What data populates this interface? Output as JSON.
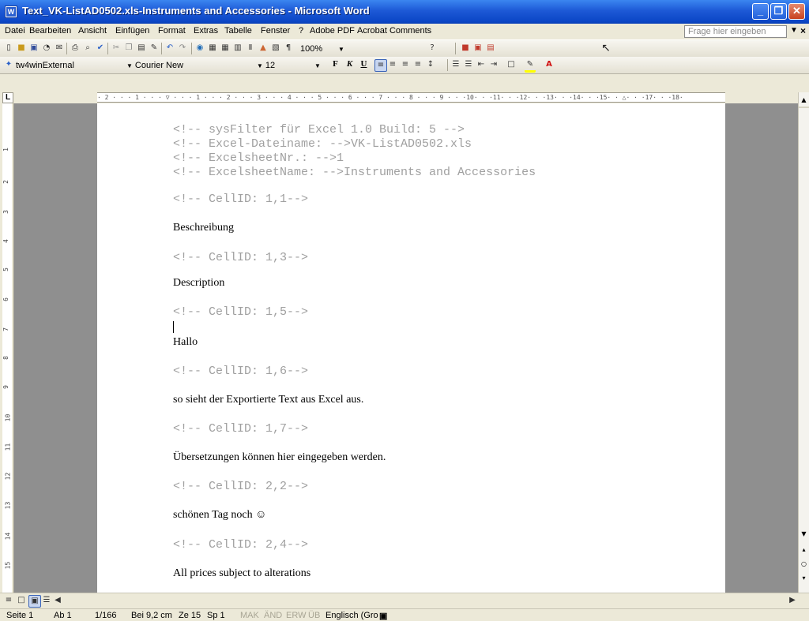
{
  "window": {
    "title": "Text_VK-ListAD0502.xls-Instruments and Accessories - Microsoft Word",
    "app_icon": "W",
    "accent": "#1d59d6",
    "close_color": "#c8421f"
  },
  "menu": {
    "items": [
      "Datei",
      "Bearbeiten",
      "Ansicht",
      "Einfügen",
      "Format",
      "Extras",
      "Tabelle",
      "Fenster",
      "?",
      "Adobe PDF",
      "Acrobat Comments"
    ],
    "help_placeholder": "Frage hier eingeben"
  },
  "toolbar": {
    "zoom": "100%",
    "style": "tw4winExternal",
    "font": "Courier New",
    "size": "12",
    "bold": "F",
    "italic": "K",
    "underline": "U"
  },
  "ruler": {
    "text": "· 2 · · · 1 · · · ▽ · · · 1 · · · 2 · · · 3 · · · 4 · · · 5 · · · 6 · · · 7 · · · 8 · · · 9 · · ·10· · ·11· · ·12· · ·13· · ·14· · ·15· · △· · ·17· · ·18·",
    "v_numbers": [
      "1",
      "2",
      "3",
      "4",
      "5",
      "6",
      "7",
      "8",
      "9",
      "10",
      "11",
      "12",
      "13",
      "14",
      "15"
    ]
  },
  "document": {
    "header_comments": [
      "<!-- sysFilter für Excel 1.0 Build: 5 -->",
      "<!-- Excel-Dateiname: -->VK-ListAD0502.xls",
      "<!-- ExcelsheetNr.: -->1",
      "<!-- ExcelsheetName: -->Instruments and Accessories"
    ],
    "blocks": [
      {
        "comment": "<!-- CellID: 1,1-->",
        "text": "Beschreibung"
      },
      {
        "comment": "<!-- CellID: 1,3-->",
        "text": "Description"
      },
      {
        "comment": "<!-- CellID: 1,5-->",
        "text": "Hallo"
      },
      {
        "comment": "<!-- CellID: 1,6-->",
        "text": "so sieht der Exportierte Text aus Excel aus."
      },
      {
        "comment": "<!-- CellID: 1,7-->",
        "text": "Übersetzungen können hier eingegeben werden."
      },
      {
        "comment": "<!-- CellID: 2,2-->",
        "text": "schönen Tag noch ☺"
      },
      {
        "comment": "<!-- CellID: 2,4-->",
        "text": "All prices subject to alterations"
      }
    ]
  },
  "status": {
    "page": "Seite 1",
    "section": "Ab 1",
    "pages": "1/166",
    "position": "Bei 9,2 cm",
    "line": "Ze 15",
    "column": "Sp 1",
    "mak": "MAK",
    "and": "ÄND",
    "erw": "ERW",
    "ub": "ÜB",
    "language": "Englisch (Gro"
  }
}
